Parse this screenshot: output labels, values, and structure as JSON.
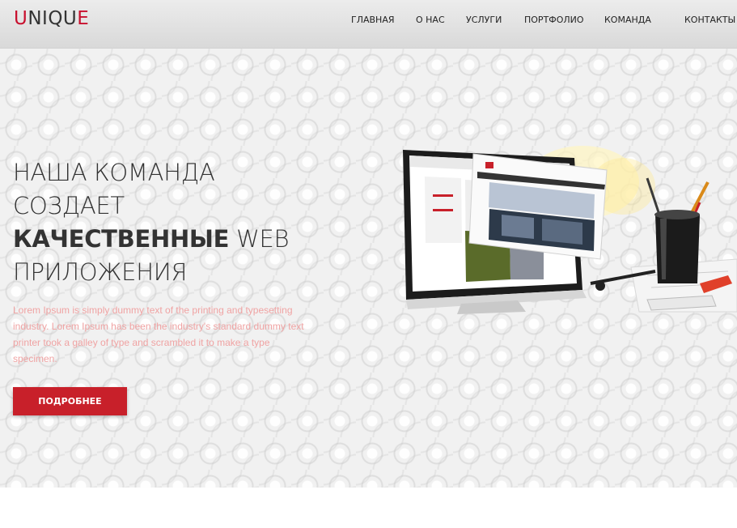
{
  "header": {
    "logo_u": "U",
    "logo_mid": "NIQU",
    "logo_e": "E",
    "nav": [
      "ГЛАВНАЯ",
      "О НАС",
      "УСЛУГИ",
      "ПОРТФОЛИО",
      "КОМАНДА",
      "КОНТАКТЫ"
    ]
  },
  "hero": {
    "title_line1": "НАША КОМАНДА",
    "title_line2": "СОЗДАЕТ",
    "title_bold": "КАЧЕСТВЕННЫЕ",
    "title_web": "WEB",
    "title_line4": "ПРИЛОЖЕНИЯ",
    "text": "Lorem Ipsum is simply dummy text of the printing and typesetting industry. Lorem Ipsum has been the industry's standard dummy text printer took a galley of type and scrambled it to make a type specimen.",
    "button_label": "ПОДРОБНЕЕ"
  },
  "colors": {
    "accent": "#c8202a",
    "text_dark": "#333333",
    "text_pink": "#f0a3a3"
  },
  "icons": [
    "monitor-illustration",
    "pencil-cup-icon",
    "eraser-icon"
  ]
}
